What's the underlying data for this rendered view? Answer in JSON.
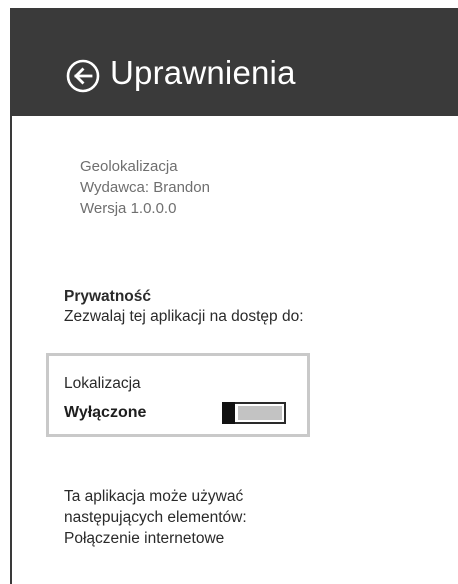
{
  "header": {
    "title": "Uprawnienia",
    "back_icon": "back-arrow-circle-icon",
    "background": "#3a3a3a"
  },
  "app_info": {
    "name": "Geolokalizacja",
    "publisher": "Wydawca: Brandon",
    "version": "Wersja 1.0.0.0"
  },
  "privacy": {
    "title": "Prywatność",
    "description": "Zezwalaj tej aplikacji na dostęp do:"
  },
  "location_setting": {
    "label": "Lokalizacja",
    "state_label": "Wyłączone",
    "enabled": false
  },
  "capabilities": {
    "intro_line1": "Ta aplikacja może używać",
    "intro_line2": "następujących elementów:",
    "items": [
      "Połączenie internetowe"
    ]
  }
}
